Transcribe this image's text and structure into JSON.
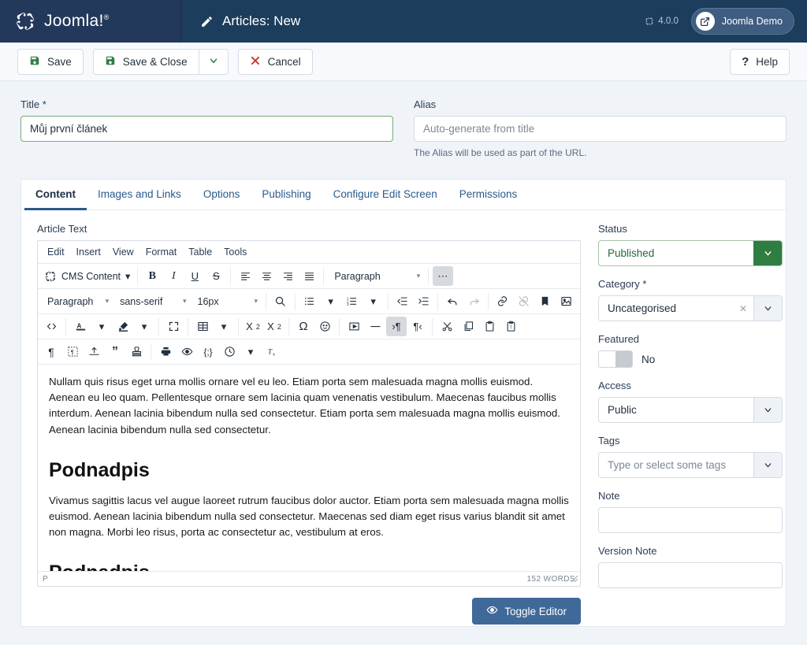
{
  "header": {
    "brand_name": "Joomla!",
    "brand_sup": "®",
    "page_title": "Articles: New",
    "version": "4.0.0",
    "demo_label": "Joomla Demo"
  },
  "toolbar": {
    "save_label": "Save",
    "save_close_label": "Save & Close",
    "cancel_label": "Cancel",
    "help_label": "Help"
  },
  "fields": {
    "title_label": "Title *",
    "title_value": "Můj první článek",
    "alias_label": "Alias",
    "alias_placeholder": "Auto-generate from title",
    "alias_help": "The Alias will be used as part of the URL."
  },
  "tabs": [
    {
      "label": "Content",
      "active": true
    },
    {
      "label": "Images and Links",
      "active": false
    },
    {
      "label": "Options",
      "active": false
    },
    {
      "label": "Publishing",
      "active": false
    },
    {
      "label": "Configure Edit Screen",
      "active": false
    },
    {
      "label": "Permissions",
      "active": false
    }
  ],
  "editor": {
    "section_label": "Article Text",
    "menubar": [
      "Edit",
      "Insert",
      "View",
      "Format",
      "Table",
      "Tools"
    ],
    "cms_content_label": "CMS Content",
    "block_format": "Paragraph",
    "block_format_2": "Paragraph",
    "font_family": "sans-serif",
    "font_size": "16px",
    "status_element": "P",
    "word_count": "152 WORDS",
    "toggle_editor_label": "Toggle Editor",
    "body": {
      "paragraph1": "Nullam quis risus eget urna mollis ornare vel eu leo. Etiam porta sem malesuada magna mollis euismod. Aenean eu leo quam. Pellentesque ornare sem lacinia quam venenatis vestibulum. Maecenas faucibus mollis interdum. Aenean lacinia bibendum nulla sed consectetur. Etiam porta sem malesuada magna mollis euismod. Aenean lacinia bibendum nulla sed consectetur.",
      "heading1": "Podnadpis",
      "paragraph2": "Vivamus sagittis lacus vel augue laoreet rutrum faucibus dolor auctor. Etiam porta sem malesuada magna mollis euismod. Aenean lacinia bibendum nulla sed consectetur. Maecenas sed diam eget risus varius blandit sit amet non magna. Morbi leo risus, porta ac consectetur ac, vestibulum at eros.",
      "heading2": "Podnadpis"
    }
  },
  "sidebar": {
    "status_label": "Status",
    "status_value": "Published",
    "category_label": "Category *",
    "category_value": "Uncategorised",
    "featured_label": "Featured",
    "featured_value": "No",
    "access_label": "Access",
    "access_value": "Public",
    "tags_label": "Tags",
    "tags_placeholder": "Type or select some tags",
    "note_label": "Note",
    "note_value": "",
    "version_note_label": "Version Note",
    "version_note_value": ""
  },
  "colors": {
    "header_bg": "#1c3d5c",
    "brand_bg": "#23395b",
    "accent_green": "#2f7d41",
    "accent_blue": "#3f6999",
    "danger_red": "#c9352d"
  }
}
